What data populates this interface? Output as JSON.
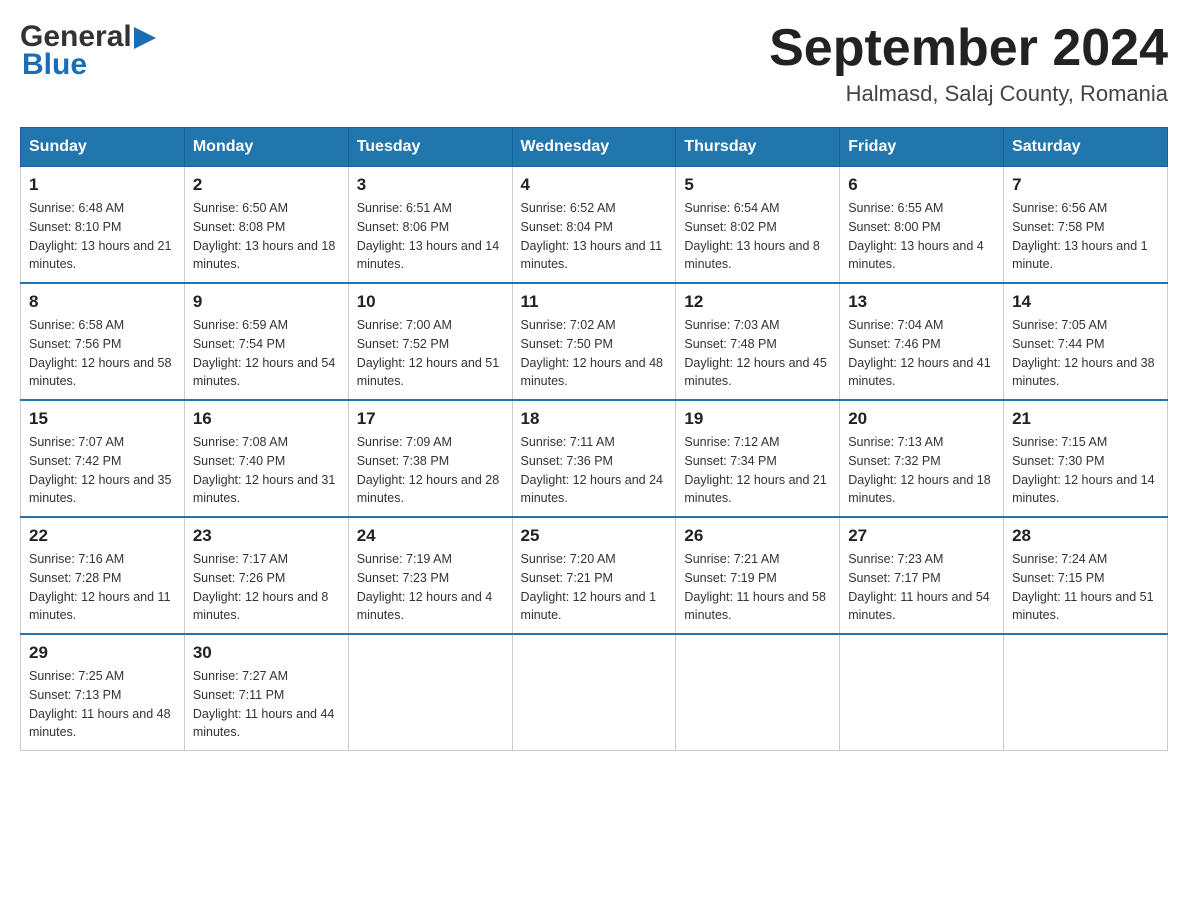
{
  "header": {
    "logo": {
      "general": "General",
      "blue": "Blue",
      "triangle": "▶"
    },
    "title": "September 2024",
    "location": "Halmasd, Salaj County, Romania"
  },
  "weekdays": [
    "Sunday",
    "Monday",
    "Tuesday",
    "Wednesday",
    "Thursday",
    "Friday",
    "Saturday"
  ],
  "weeks": [
    [
      {
        "day": "1",
        "sunrise": "Sunrise: 6:48 AM",
        "sunset": "Sunset: 8:10 PM",
        "daylight": "Daylight: 13 hours and 21 minutes."
      },
      {
        "day": "2",
        "sunrise": "Sunrise: 6:50 AM",
        "sunset": "Sunset: 8:08 PM",
        "daylight": "Daylight: 13 hours and 18 minutes."
      },
      {
        "day": "3",
        "sunrise": "Sunrise: 6:51 AM",
        "sunset": "Sunset: 8:06 PM",
        "daylight": "Daylight: 13 hours and 14 minutes."
      },
      {
        "day": "4",
        "sunrise": "Sunrise: 6:52 AM",
        "sunset": "Sunset: 8:04 PM",
        "daylight": "Daylight: 13 hours and 11 minutes."
      },
      {
        "day": "5",
        "sunrise": "Sunrise: 6:54 AM",
        "sunset": "Sunset: 8:02 PM",
        "daylight": "Daylight: 13 hours and 8 minutes."
      },
      {
        "day": "6",
        "sunrise": "Sunrise: 6:55 AM",
        "sunset": "Sunset: 8:00 PM",
        "daylight": "Daylight: 13 hours and 4 minutes."
      },
      {
        "day": "7",
        "sunrise": "Sunrise: 6:56 AM",
        "sunset": "Sunset: 7:58 PM",
        "daylight": "Daylight: 13 hours and 1 minute."
      }
    ],
    [
      {
        "day": "8",
        "sunrise": "Sunrise: 6:58 AM",
        "sunset": "Sunset: 7:56 PM",
        "daylight": "Daylight: 12 hours and 58 minutes."
      },
      {
        "day": "9",
        "sunrise": "Sunrise: 6:59 AM",
        "sunset": "Sunset: 7:54 PM",
        "daylight": "Daylight: 12 hours and 54 minutes."
      },
      {
        "day": "10",
        "sunrise": "Sunrise: 7:00 AM",
        "sunset": "Sunset: 7:52 PM",
        "daylight": "Daylight: 12 hours and 51 minutes."
      },
      {
        "day": "11",
        "sunrise": "Sunrise: 7:02 AM",
        "sunset": "Sunset: 7:50 PM",
        "daylight": "Daylight: 12 hours and 48 minutes."
      },
      {
        "day": "12",
        "sunrise": "Sunrise: 7:03 AM",
        "sunset": "Sunset: 7:48 PM",
        "daylight": "Daylight: 12 hours and 45 minutes."
      },
      {
        "day": "13",
        "sunrise": "Sunrise: 7:04 AM",
        "sunset": "Sunset: 7:46 PM",
        "daylight": "Daylight: 12 hours and 41 minutes."
      },
      {
        "day": "14",
        "sunrise": "Sunrise: 7:05 AM",
        "sunset": "Sunset: 7:44 PM",
        "daylight": "Daylight: 12 hours and 38 minutes."
      }
    ],
    [
      {
        "day": "15",
        "sunrise": "Sunrise: 7:07 AM",
        "sunset": "Sunset: 7:42 PM",
        "daylight": "Daylight: 12 hours and 35 minutes."
      },
      {
        "day": "16",
        "sunrise": "Sunrise: 7:08 AM",
        "sunset": "Sunset: 7:40 PM",
        "daylight": "Daylight: 12 hours and 31 minutes."
      },
      {
        "day": "17",
        "sunrise": "Sunrise: 7:09 AM",
        "sunset": "Sunset: 7:38 PM",
        "daylight": "Daylight: 12 hours and 28 minutes."
      },
      {
        "day": "18",
        "sunrise": "Sunrise: 7:11 AM",
        "sunset": "Sunset: 7:36 PM",
        "daylight": "Daylight: 12 hours and 24 minutes."
      },
      {
        "day": "19",
        "sunrise": "Sunrise: 7:12 AM",
        "sunset": "Sunset: 7:34 PM",
        "daylight": "Daylight: 12 hours and 21 minutes."
      },
      {
        "day": "20",
        "sunrise": "Sunrise: 7:13 AM",
        "sunset": "Sunset: 7:32 PM",
        "daylight": "Daylight: 12 hours and 18 minutes."
      },
      {
        "day": "21",
        "sunrise": "Sunrise: 7:15 AM",
        "sunset": "Sunset: 7:30 PM",
        "daylight": "Daylight: 12 hours and 14 minutes."
      }
    ],
    [
      {
        "day": "22",
        "sunrise": "Sunrise: 7:16 AM",
        "sunset": "Sunset: 7:28 PM",
        "daylight": "Daylight: 12 hours and 11 minutes."
      },
      {
        "day": "23",
        "sunrise": "Sunrise: 7:17 AM",
        "sunset": "Sunset: 7:26 PM",
        "daylight": "Daylight: 12 hours and 8 minutes."
      },
      {
        "day": "24",
        "sunrise": "Sunrise: 7:19 AM",
        "sunset": "Sunset: 7:23 PM",
        "daylight": "Daylight: 12 hours and 4 minutes."
      },
      {
        "day": "25",
        "sunrise": "Sunrise: 7:20 AM",
        "sunset": "Sunset: 7:21 PM",
        "daylight": "Daylight: 12 hours and 1 minute."
      },
      {
        "day": "26",
        "sunrise": "Sunrise: 7:21 AM",
        "sunset": "Sunset: 7:19 PM",
        "daylight": "Daylight: 11 hours and 58 minutes."
      },
      {
        "day": "27",
        "sunrise": "Sunrise: 7:23 AM",
        "sunset": "Sunset: 7:17 PM",
        "daylight": "Daylight: 11 hours and 54 minutes."
      },
      {
        "day": "28",
        "sunrise": "Sunrise: 7:24 AM",
        "sunset": "Sunset: 7:15 PM",
        "daylight": "Daylight: 11 hours and 51 minutes."
      }
    ],
    [
      {
        "day": "29",
        "sunrise": "Sunrise: 7:25 AM",
        "sunset": "Sunset: 7:13 PM",
        "daylight": "Daylight: 11 hours and 48 minutes."
      },
      {
        "day": "30",
        "sunrise": "Sunrise: 7:27 AM",
        "sunset": "Sunset: 7:11 PM",
        "daylight": "Daylight: 11 hours and 44 minutes."
      },
      null,
      null,
      null,
      null,
      null
    ]
  ]
}
